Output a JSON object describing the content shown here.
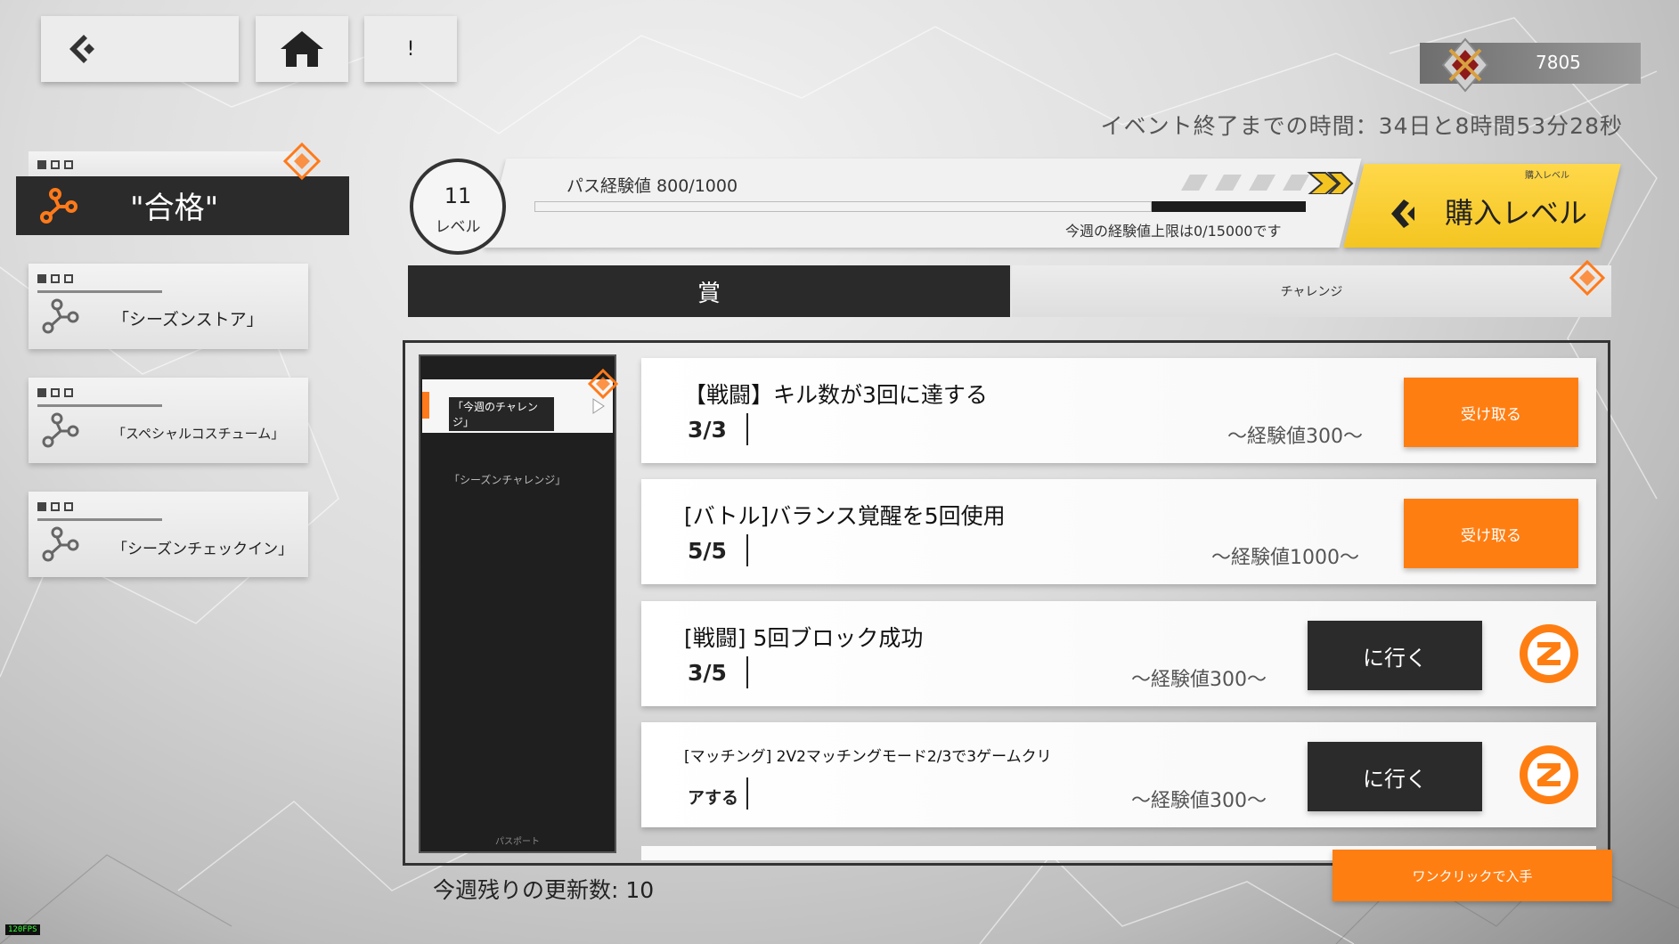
{
  "header": {
    "info_label": "!",
    "currency_value": "7805",
    "event_timer": "イベント終了までの時間：34日と8時間53分28秒"
  },
  "nav": {
    "active_label": "\"合格\"",
    "items": [
      {
        "label": "「シーズンストア」"
      },
      {
        "label": "「スペシャルコスチューム」"
      },
      {
        "label": "「シーズンチェックイン」"
      }
    ]
  },
  "pass": {
    "level_number": "11",
    "level_label": "レベル",
    "exp_label": "パス経験値 800/1000",
    "exp_current": 800,
    "exp_max": 1000,
    "weekly_cap": "今週の経験値上限は0/15000です",
    "buy_level_label": "購入レベル",
    "buy_level_small": "購入レベル"
  },
  "tabs": {
    "reward": "賞",
    "challenge": "チャレンジ"
  },
  "side_list": {
    "weekly": "「今週のチャレンジ」",
    "season": "「シーズンチャレンジ」",
    "footer": "パスポート"
  },
  "quests": [
    {
      "title": "【戦闘】キル数が3回に達する",
      "progress": "3/3",
      "exp": "～経験値300～",
      "action": "受け取る"
    },
    {
      "title": "[バトル]バランス覚醒を5回使用",
      "progress": "5/5",
      "exp": "～経験値1000～",
      "action": "受け取る"
    },
    {
      "title": "[戦闘] 5回ブロック成功",
      "progress": "3/5",
      "exp": "～経験値300～",
      "action": "に行く"
    },
    {
      "title": "[マッチング] 2V2マッチングモード2/3で3ゲームクリ",
      "progress": "アする",
      "exp": "～経験値300～",
      "action": "に行く"
    }
  ],
  "footer": {
    "remaining_refresh": "今週残りの更新数: 10",
    "one_click": "ワンクリックで入手",
    "fps": "120FPS"
  },
  "colors": {
    "accent_orange": "#ff7e12",
    "buy_yellow": "#f4c521",
    "dark": "#2b2b2b"
  },
  "icons": [
    "back-icon",
    "home-icon",
    "currency-emblem-icon",
    "network-icon",
    "chevron-left-icon",
    "go-z-icon",
    "diamond-marker-icon"
  ]
}
